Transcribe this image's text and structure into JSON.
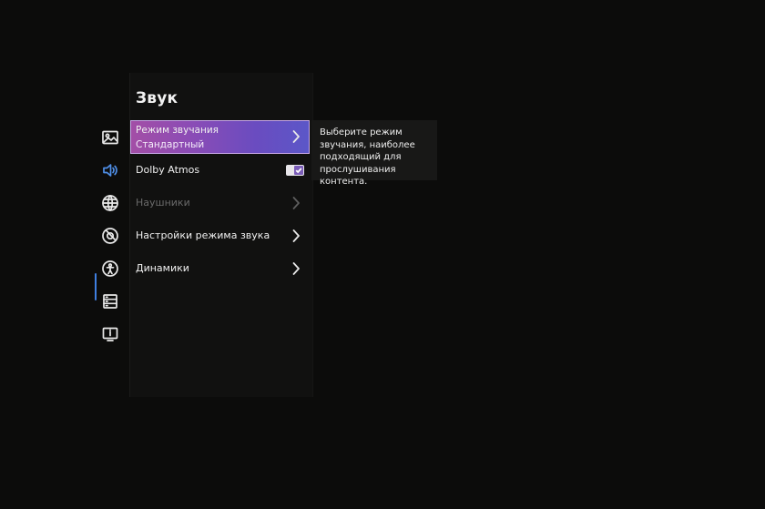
{
  "sidebar": {
    "icons": [
      {
        "name": "picture-icon",
        "active": false
      },
      {
        "name": "sound-icon",
        "active": true
      },
      {
        "name": "network-icon",
        "active": false
      },
      {
        "name": "general-settings-icon",
        "active": false
      },
      {
        "name": "accessibility-icon",
        "active": false
      },
      {
        "name": "system-icon",
        "active": false
      },
      {
        "name": "support-icon",
        "active": false
      }
    ],
    "active_color": "#4f8fe8"
  },
  "panel": {
    "title": "Звук",
    "items": [
      {
        "label": "Режим звучания",
        "value": "Стандартный",
        "selected": true,
        "type": "submenu"
      },
      {
        "label": "Dolby Atmos",
        "type": "toggle",
        "checked": true
      },
      {
        "label": "Наушники",
        "type": "submenu",
        "disabled": true
      },
      {
        "label": "Настройки режима звука",
        "type": "submenu"
      },
      {
        "label": "Динамики",
        "type": "submenu"
      }
    ]
  },
  "help": {
    "text": "Выберите режим\nзвучания, наиболее\nподходящий для\nпрослушивания контента."
  },
  "colors": {
    "background": "#0b0b0b",
    "highlight_start": "#a34ea6",
    "highlight_end": "#5b57c8",
    "toggle_accent": "#7b5db8"
  }
}
